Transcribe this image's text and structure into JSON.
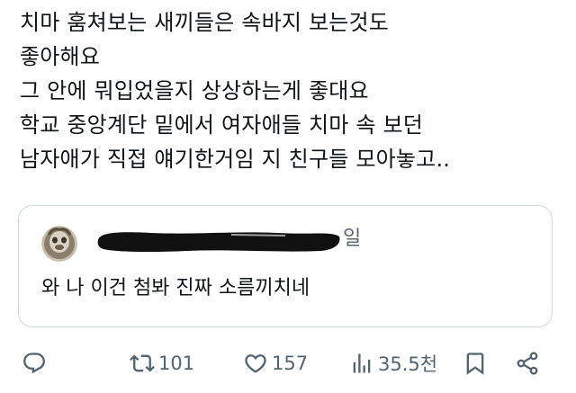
{
  "post": {
    "lines": [
      "치마 훔쳐보는 새끼들은 속바지 보는것도",
      "좋아해요",
      "그 안에 뭐입었을지 상상하는게 좋대요",
      "학교 중앙계단 밑에서 여자애들 치마 속 보던",
      "남자애가 직접 얘기한거임 지 친구들 모아놓고.."
    ]
  },
  "quote": {
    "date_suffix": "일",
    "text": "와 나 이건 첨봐 진짜 소름끼치네"
  },
  "actions": {
    "reply_icon": "reply-icon",
    "repost_icon": "repost-icon",
    "repost_count": "101",
    "like_icon": "heart-icon",
    "like_count": "157",
    "views_icon": "bar-chart-icon",
    "views_count": "35.5천",
    "bookmark_icon": "bookmark-icon",
    "share_icon": "share-icon"
  },
  "colors": {
    "text_primary": "#0f1419",
    "text_secondary": "#536471",
    "border": "#cfd9de",
    "redaction": "#111111"
  }
}
